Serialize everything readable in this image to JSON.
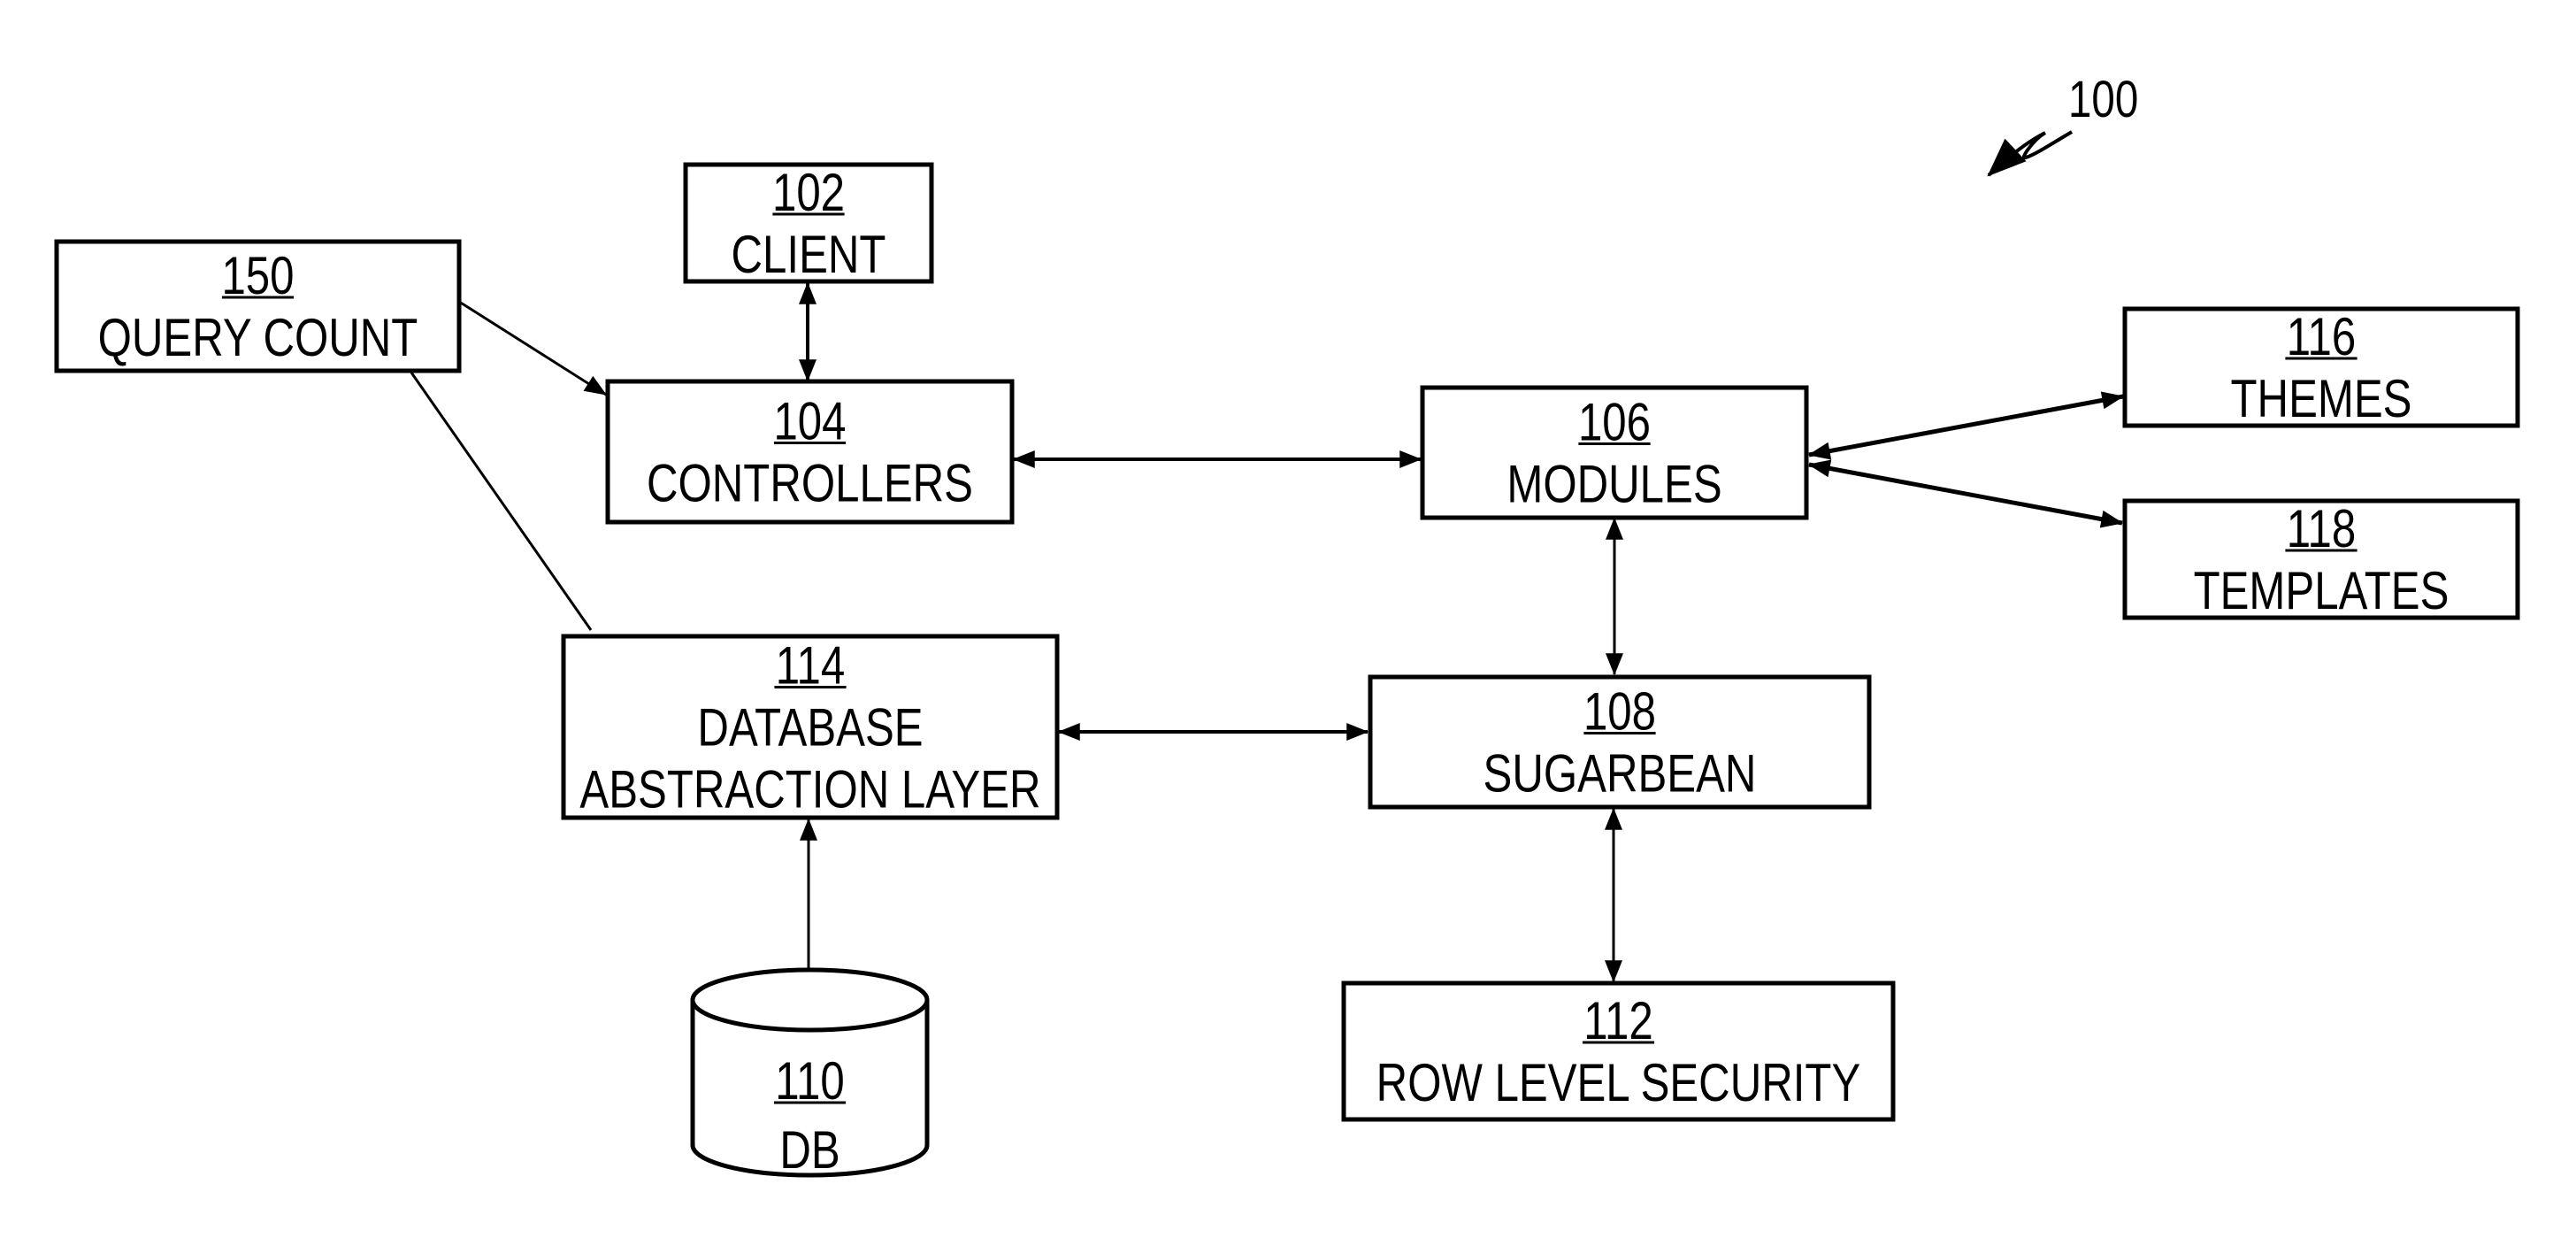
{
  "figure": {
    "reference": "100",
    "description": "System architecture block diagram"
  },
  "colors": {
    "ink": "#000000",
    "background": "#ffffff"
  },
  "nodes": [
    {
      "id": "n150",
      "ref": "150",
      "lines": [
        "QUERY COUNT"
      ],
      "shape": "rect"
    },
    {
      "id": "n102",
      "ref": "102",
      "lines": [
        "CLIENT"
      ],
      "shape": "rect"
    },
    {
      "id": "n104",
      "ref": "104",
      "lines": [
        "CONTROLLERS"
      ],
      "shape": "rect"
    },
    {
      "id": "n106",
      "ref": "106",
      "lines": [
        "MODULES"
      ],
      "shape": "rect"
    },
    {
      "id": "n116",
      "ref": "116",
      "lines": [
        "THEMES"
      ],
      "shape": "rect"
    },
    {
      "id": "n118",
      "ref": "118",
      "lines": [
        "TEMPLATES"
      ],
      "shape": "rect"
    },
    {
      "id": "n114",
      "ref": "114",
      "lines": [
        "DATABASE",
        "ABSTRACTION LAYER"
      ],
      "shape": "rect"
    },
    {
      "id": "n108",
      "ref": "108",
      "lines": [
        "SUGARBEAN"
      ],
      "shape": "rect"
    },
    {
      "id": "n110",
      "ref": "110",
      "lines": [
        "DB"
      ],
      "shape": "cylinder"
    },
    {
      "id": "n112",
      "ref": "112",
      "lines": [
        "ROW LEVEL SECURITY"
      ],
      "shape": "rect"
    }
  ],
  "edges": [
    {
      "from": "n102",
      "to": "n104",
      "direction": "both"
    },
    {
      "from": "n150",
      "to": "n104",
      "direction": "forward"
    },
    {
      "from": "n150",
      "to": "n114",
      "direction": "none"
    },
    {
      "from": "n104",
      "to": "n106",
      "direction": "both"
    },
    {
      "from": "n106",
      "to": "n116",
      "direction": "both"
    },
    {
      "from": "n106",
      "to": "n118",
      "direction": "both"
    },
    {
      "from": "n106",
      "to": "n108",
      "direction": "both"
    },
    {
      "from": "n114",
      "to": "n108",
      "direction": "both"
    },
    {
      "from": "n114",
      "to": "n110",
      "direction": "both"
    },
    {
      "from": "n108",
      "to": "n112",
      "direction": "both"
    }
  ]
}
